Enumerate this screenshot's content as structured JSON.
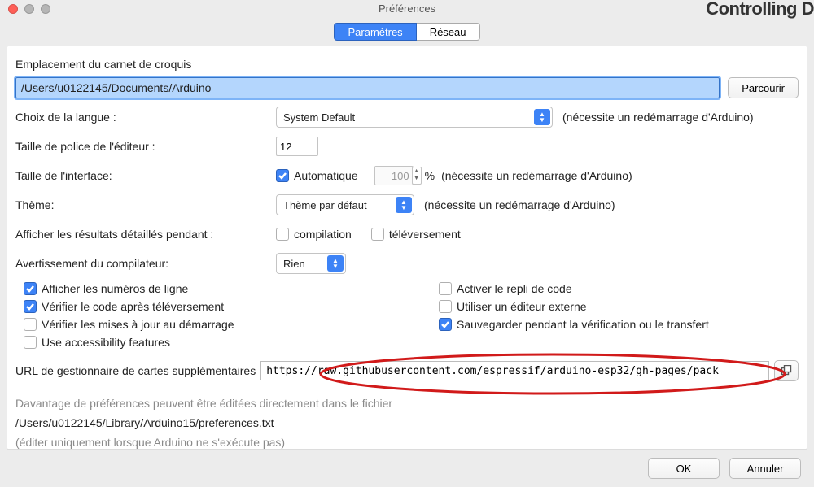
{
  "window": {
    "title": "Préférences",
    "bg_cut": "Controlling D"
  },
  "tabs": {
    "params": "Paramètres",
    "network": "Réseau"
  },
  "sketch": {
    "label": "Emplacement du carnet de croquis",
    "path": "/Users/u0122145/Documents/Arduino",
    "browse": "Parcourir"
  },
  "lang": {
    "label": "Choix de la langue :",
    "value": "System Default",
    "hint": "(nécessite un redémarrage d'Arduino)"
  },
  "font": {
    "label": "Taille de police de l'éditeur :",
    "value": "12"
  },
  "iscale": {
    "label": "Taille de l'interface:",
    "auto": "Automatique",
    "value": "100",
    "pct": "%",
    "hint": "(nécessite un redémarrage d'Arduino)"
  },
  "theme": {
    "label": "Thème:",
    "value": "Thème par défaut",
    "hint": "(nécessite un redémarrage d'Arduino)"
  },
  "verbose": {
    "label": "Afficher les résultats détaillés pendant :",
    "compile": "compilation",
    "upload": "téléversement"
  },
  "warn": {
    "label": "Avertissement du compilateur:",
    "value": "Rien"
  },
  "opts": {
    "linenos": "Afficher les numéros de ligne",
    "fold": "Activer le repli de code",
    "verify": "Vérifier le code après téléversement",
    "ext": "Utiliser un éditeur externe",
    "updates": "Vérifier les mises à jour au démarrage",
    "save": "Sauvegarder pendant la vérification ou le transfert",
    "a11y": "Use accessibility features"
  },
  "urls": {
    "label": "URL de gestionnaire de cartes supplémentaires",
    "value": "https://raw.githubusercontent.com/espressif/arduino-esp32/gh-pages/pack"
  },
  "foot": {
    "l1": "Davantage de préférences peuvent être éditées directement dans le fichier",
    "l2": "/Users/u0122145/Library/Arduino15/preferences.txt",
    "l3": "(éditer uniquement lorsque Arduino ne s'exécute pas)"
  },
  "buttons": {
    "ok": "OK",
    "cancel": "Annuler"
  }
}
